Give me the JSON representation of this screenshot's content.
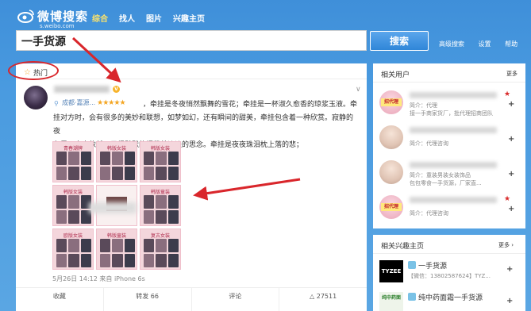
{
  "header": {
    "logo_title": "微博搜索",
    "logo_sub": "s.weibo.com",
    "nav": [
      "综合",
      "找人",
      "图片",
      "兴趣主页"
    ]
  },
  "search": {
    "query": "一手货源",
    "button": "搜索",
    "links": [
      "高级搜索",
      "设置",
      "帮助"
    ]
  },
  "feed": {
    "tab": "热门",
    "location": "成都·嘉源...",
    "stars": "★★★★★",
    "text_lines": [
      "，牵挂是冬夜悄然飘舞的雪花；牵挂是一杯淑久愈香的琼浆玉液。牵",
      "挂对方时，会有很多的美妙和联想，如梦如幻，还有瞬间的甜美，牵挂包含着一种欣赏。寂静的夜",
      "色里，寂寞依然，只得默默的埋藏着淡淡的思念。牵挂是夜夜珠泪枕上落的悲；"
    ],
    "tiles": [
      "青春潮牌",
      "韩版女装",
      "韩版女装",
      "",
      "",
      "",
      "韩版女装",
      "",
      "韩版童装",
      "",
      "",
      "",
      "欧版女装",
      "韩版童装",
      "复古女装"
    ],
    "time": "5月26日 14:12 来自 iPhone 6s",
    "actions": [
      "收藏",
      "转发 66",
      "评论",
      "△ 27511"
    ]
  },
  "side_users": {
    "title": "相关用户",
    "more": "更多",
    "users": [
      {
        "tag": "招代理",
        "desc": "简介：代理",
        "desc2": "接一手商家货厂，批代理招商团队"
      },
      {
        "tag": "",
        "desc": "",
        "desc2": "简介：代理咨询"
      },
      {
        "tag": "",
        "desc": "简介：童装男装女装饰品",
        "desc2": "包包零食一手货源，厂家直..."
      },
      {
        "tag": "招代理",
        "desc": "简介：代理咨询",
        "desc2": ""
      }
    ]
  },
  "side_topics": {
    "title": "相关兴趣主页",
    "more": "更多",
    "topics": [
      {
        "icon": "TYZEE",
        "name": "一手货源",
        "sub": "【微信：13802587624】TYZ..."
      },
      {
        "icon": "纯中药面",
        "name": "纯中药面霜一手货源",
        "sub": ""
      }
    ]
  },
  "colors": {
    "brand_blue": "#3e8ed8",
    "nav_active": "#ffe46a",
    "annotation_red": "#d9262b",
    "star_orange": "#f4a623"
  }
}
